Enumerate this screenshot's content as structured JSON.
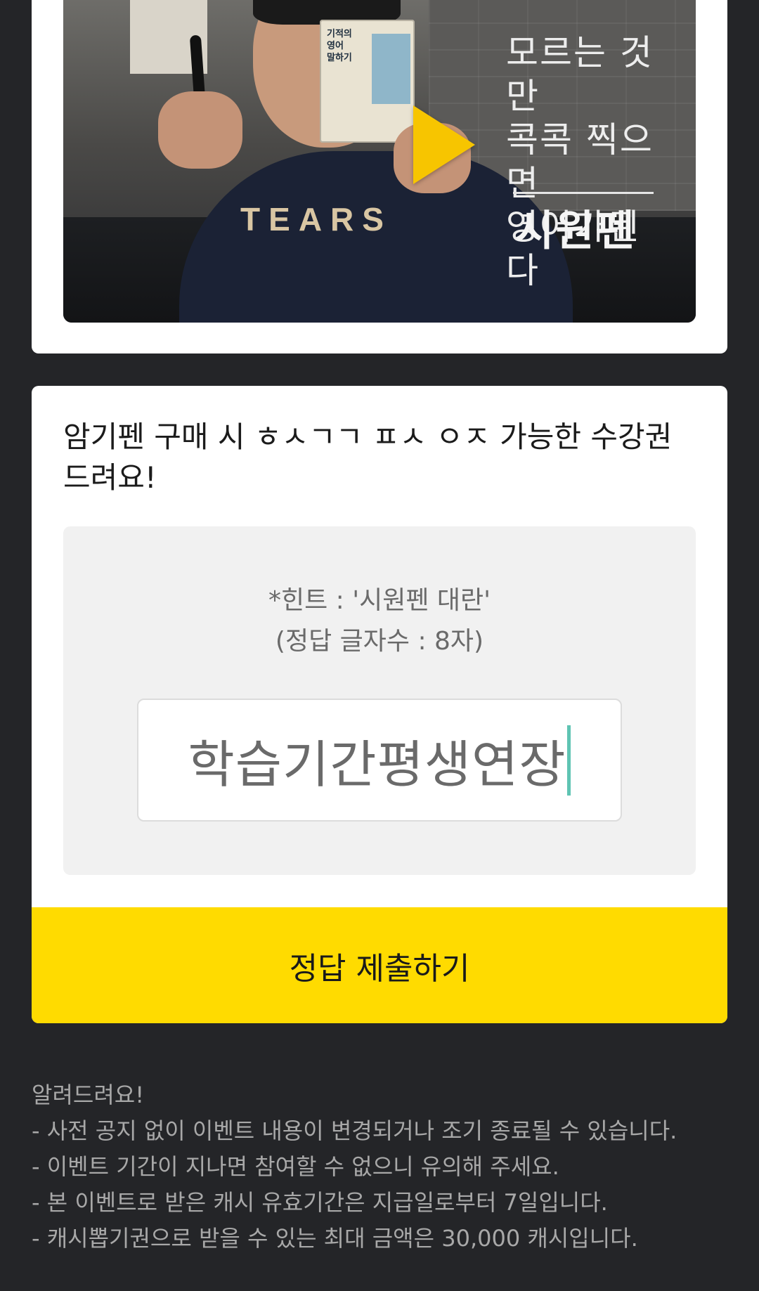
{
  "video": {
    "book_title": "기적의\n영어\n말하기",
    "shirt_text": "TEARS",
    "overlay_text": "모르는 것만\n콕콕 찍으면\n영어가된다",
    "overlay_brand": "시원펜",
    "play_icon": "play-icon",
    "play_color": "#f7c500"
  },
  "quiz": {
    "question": "암기펜 구매 시 ㅎㅅㄱㄱ ㅍㅅ ㅇㅈ 가능한 수강권 드려요!",
    "hint_line1": "*힌트 : '시원펜 대란'",
    "hint_line2": "(정답 글자수 : 8자)",
    "answer_value": "학습기간평생연장",
    "submit_label": "정답 제출하기",
    "submit_color": "#ffdb00"
  },
  "notice": {
    "title": "알려드려요!",
    "items": [
      "- 사전 공지 없이 이벤트 내용이 변경되거나 조기 종료될 수 있습니다.",
      "- 이벤트 기간이 지나면 참여할 수 없으니 유의해 주세요.",
      "- 본 이벤트로 받은 캐시 유효기간은 지급일로부터 7일입니다.",
      "- 캐시뽑기권으로 받을 수 있는 최대 금액은 30,000 캐시입니다."
    ]
  }
}
